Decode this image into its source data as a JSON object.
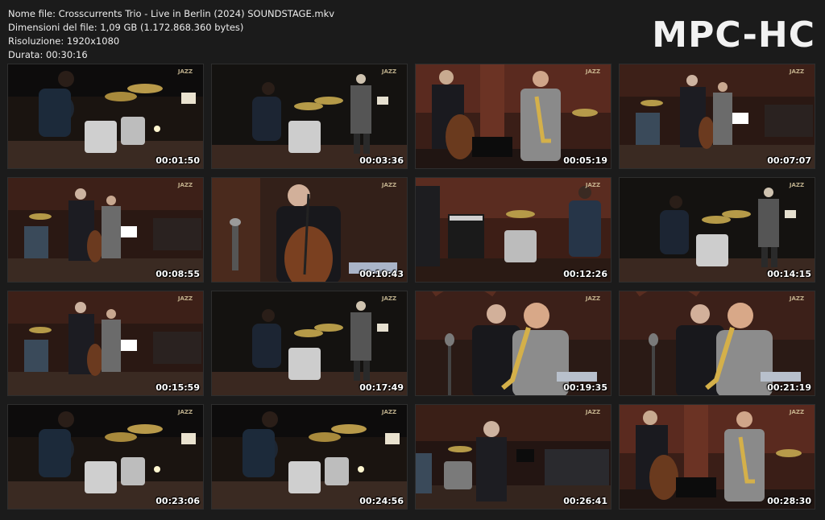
{
  "header": {
    "file_name": "Nome file: Crosscurrents Trio - Live in Berlin (2024) SOUNDSTAGE.mkv",
    "file_size": "Dimensioni del file: 1,09 GB (1.172.868.360 bytes)",
    "resolution": "Risoluzione: 1920x1080",
    "duration": "Durata: 00:30:16"
  },
  "logo": "MPC-HC",
  "thumbnails": [
    {
      "time": "00:01:50",
      "scene": "drummer"
    },
    {
      "time": "00:03:36",
      "scene": "drummer-wide"
    },
    {
      "time": "00:05:19",
      "scene": "sax-bass"
    },
    {
      "time": "00:07:07",
      "scene": "stage-wide"
    },
    {
      "time": "00:08:55",
      "scene": "stage-wide"
    },
    {
      "time": "00:10:43",
      "scene": "bassist-close"
    },
    {
      "time": "00:12:26",
      "scene": "drummer-amp"
    },
    {
      "time": "00:14:15",
      "scene": "drummer-wide"
    },
    {
      "time": "00:15:59",
      "scene": "stage-wide"
    },
    {
      "time": "00:17:49",
      "scene": "drummer-wide"
    },
    {
      "time": "00:19:35",
      "scene": "sax-close"
    },
    {
      "time": "00:21:19",
      "scene": "sax-close"
    },
    {
      "time": "00:23:06",
      "scene": "drummer"
    },
    {
      "time": "00:24:56",
      "scene": "drummer"
    },
    {
      "time": "00:26:41",
      "scene": "stage-back"
    },
    {
      "time": "00:28:30",
      "scene": "sax-bass"
    }
  ],
  "watermark": "JAZZ"
}
